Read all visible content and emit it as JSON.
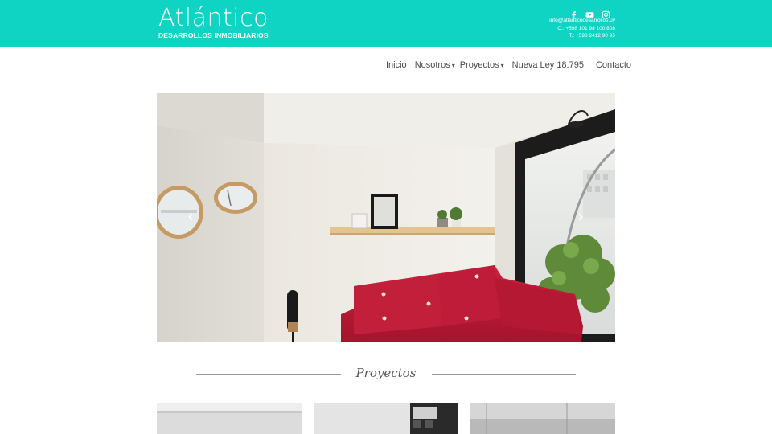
{
  "header": {
    "logo_name": "Atlántico",
    "logo_sub": "DESARROLLOS INMOBILIARIOS",
    "social": [
      "facebook-icon",
      "youtube-icon",
      "instagram-icon"
    ],
    "email": "info@atlanticodesarrollos.uy",
    "phone_cel": "C.: +598 101 98 100 808",
    "phone_tel": "T.: +598 2412 90 95"
  },
  "nav": {
    "items": [
      {
        "label": "Inicio"
      },
      {
        "label": "Nosotros"
      },
      {
        "label": "Proyectos"
      },
      {
        "label": "Nueva Ley 18.795"
      },
      {
        "label": "Contacto"
      }
    ],
    "caret": "▾"
  },
  "slider": {
    "prev": "‹",
    "next": "›"
  },
  "section": {
    "title": "Proyectos"
  },
  "colors": {
    "brand": "#10d4c3",
    "sofa": "#c41f3a"
  }
}
